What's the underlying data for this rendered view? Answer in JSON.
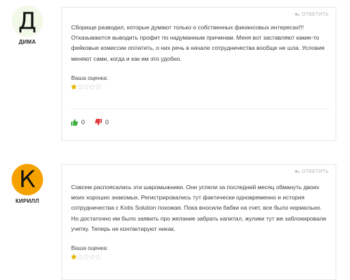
{
  "comments": [
    {
      "avatar_letter": "Д",
      "avatar_color": "#f2f9e8",
      "author": "ДИМА",
      "reply_label": "ОТВЕТИТЬ",
      "text": "Сборище разводил, которые думают только о собственных финансовых интересах!!! Отказываются выводить профит по надуманным причинам. Меня вот заставляют какие-то фейковые комиссии оплатить, о них речь в начале сотрудничества вообще не шла. Условия меняют сами, когда и как им это удобно.",
      "rating_label": "Ваша оценка:",
      "rating": 1,
      "rating_max": 5,
      "likes": "0",
      "dislikes": "0"
    },
    {
      "avatar_letter": "К",
      "avatar_color": "#f5a200",
      "author": "КИРИЛЛ",
      "reply_label": "ОТВЕТИТЬ",
      "text": "Совсем распоясались эти шаромыжники. Они успели за последний месяц обмануть двоих моих хороших знакомых. Регистрировались тут фактически одновременно и история сотрудничества с Kotis Solution похожая. Пока вносили бабки на счет, все было нормально. Но достаточно им было заявить про желание забрать капитал, жулики тут же заблокировали учетку. Теперь не контактируют никак.",
      "rating_label": "Ваша оценка:",
      "rating": 1,
      "rating_max": 5
    }
  ],
  "colors": {
    "star_filled": "#e8b400",
    "star_empty": "#dcdcdc",
    "like": "#3cae3c",
    "dislike": "#e0393e"
  }
}
